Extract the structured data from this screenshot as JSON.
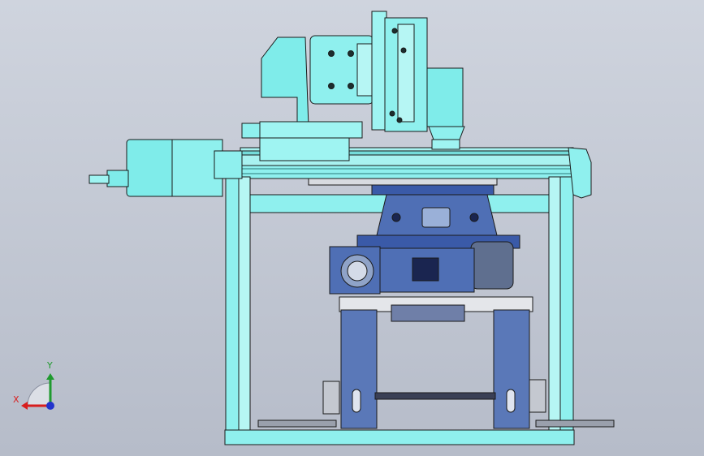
{
  "view": {
    "background_top": "#cfd4de",
    "background_bottom": "#b6bcc9",
    "colors": {
      "cyan_part": "#7fecea",
      "cyan_dark": "#3fb6b6",
      "blue_part": "#4f6fb5",
      "blue_dark": "#233a78",
      "outline": "#1a1a1a",
      "plate_grey": "#d8dbe0"
    }
  },
  "triad": {
    "x_label": "X",
    "y_label": "Y",
    "x_color": "#d81e1e",
    "y_color": "#1f9a2e",
    "z_color": "#2233cc"
  }
}
